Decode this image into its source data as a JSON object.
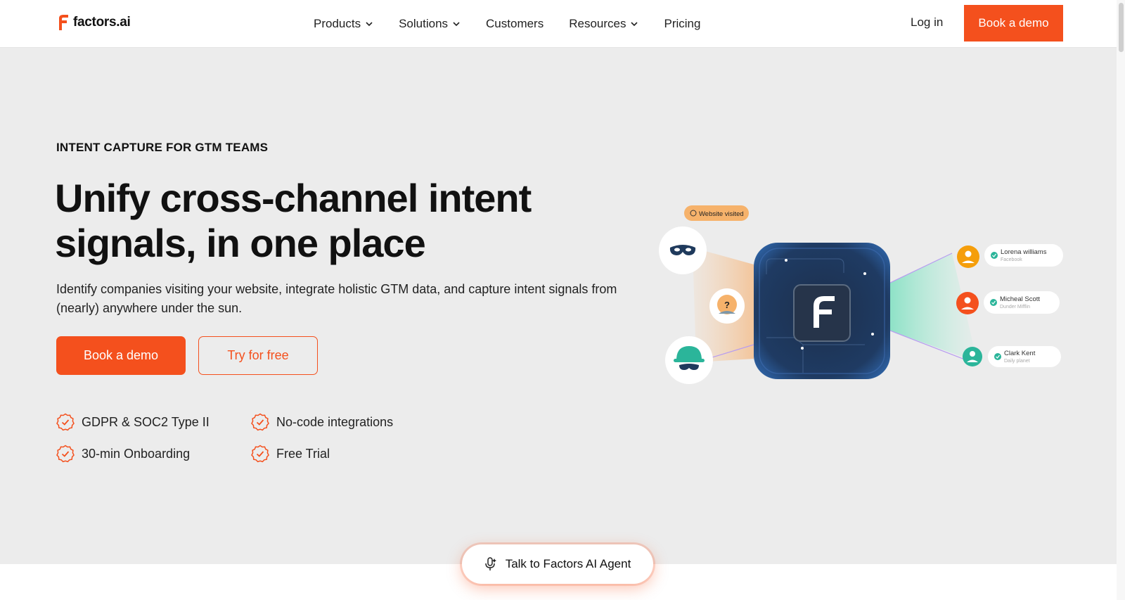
{
  "brand": {
    "name": "factors.ai",
    "accent": "#f4501d"
  },
  "nav": {
    "links": [
      {
        "label": "Products",
        "dropdown": true
      },
      {
        "label": "Solutions",
        "dropdown": true
      },
      {
        "label": "Customers",
        "dropdown": false
      },
      {
        "label": "Resources",
        "dropdown": true
      },
      {
        "label": "Pricing",
        "dropdown": false
      }
    ],
    "login": "Log in",
    "demo": "Book a demo"
  },
  "hero": {
    "eyebrow": "INTENT CAPTURE FOR GTM TEAMS",
    "headline_line1": "Unify cross-channel intent",
    "headline_line2": "signals, in one place",
    "subtitle": "Identify companies visiting your website, integrate holistic GTM data, and capture intent signals from (nearly) anywhere under the sun.",
    "primary_cta": "Book a demo",
    "secondary_cta": "Try for free",
    "features": [
      "GDPR & SOC2 Type II",
      "No-code integrations",
      "30-min Onboarding",
      "Free Trial"
    ]
  },
  "illustration": {
    "badge": "Website visited",
    "people": [
      {
        "name": "Lorena williams",
        "company": "Facebook",
        "color": "#f59e0b"
      },
      {
        "name": "Micheal Scott",
        "company": "Dunder Mifflin",
        "color": "#f4501d"
      },
      {
        "name": "Clark Kent",
        "company": "Daily planet",
        "color": "#2bb59a"
      }
    ],
    "unknown_mark": "?"
  },
  "agent": {
    "label": "Talk to Factors AI Agent"
  }
}
